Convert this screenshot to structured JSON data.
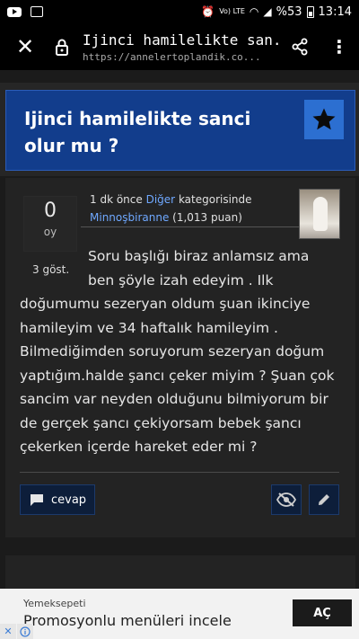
{
  "status_bar": {
    "signal_label": "Vo) LTE",
    "battery_level": "%53",
    "time": "13:14"
  },
  "browser": {
    "page_title": "Ijinci hamilelikte san...",
    "url": "https://annelertoplandik.co...",
    "icons": [
      "close-icon",
      "lock-icon",
      "share-icon",
      "more-vert-icon"
    ]
  },
  "question": {
    "title": "Ijinci hamilelikte sanci olur mu ?",
    "vote_count": "0",
    "vote_unit": "oy",
    "views": "3 göst.",
    "meta": {
      "time": "1 dk önce",
      "category": "Diğer",
      "category_suffix": "kategorisinde",
      "author": "Minnoşbiranne",
      "points": "(1,013 puan)"
    },
    "body_lines": [
      "Soru başlığı biraz anlamsız ama",
      "ben şöyle izah edeyim . Ilk",
      "doğumumu sezeryan oldum şuan ikinciye",
      "hamileyim ve 34 haftalık hamileyim .",
      "Bilmediğimden soruyorum sezeryan doğum",
      "yaptığım.halde şancı çeker miyim ? Şuan çok",
      "sancim var neyden olduğunu bilmiyorum bir",
      "de gerçek şancı çekiyorsam bebek şancı",
      "çekerken içerde hareket eder mi ?"
    ],
    "actions": {
      "reply_label": "cevap"
    }
  },
  "ad": {
    "brand": "Yemeksepeti",
    "text": "Promosyonlu menüleri incele",
    "cta": "AÇ",
    "close_glyph": "✕"
  },
  "colors": {
    "title_card": "#123d8c",
    "link": "#6fa8ff",
    "button_bg": "#0d1e3a"
  }
}
